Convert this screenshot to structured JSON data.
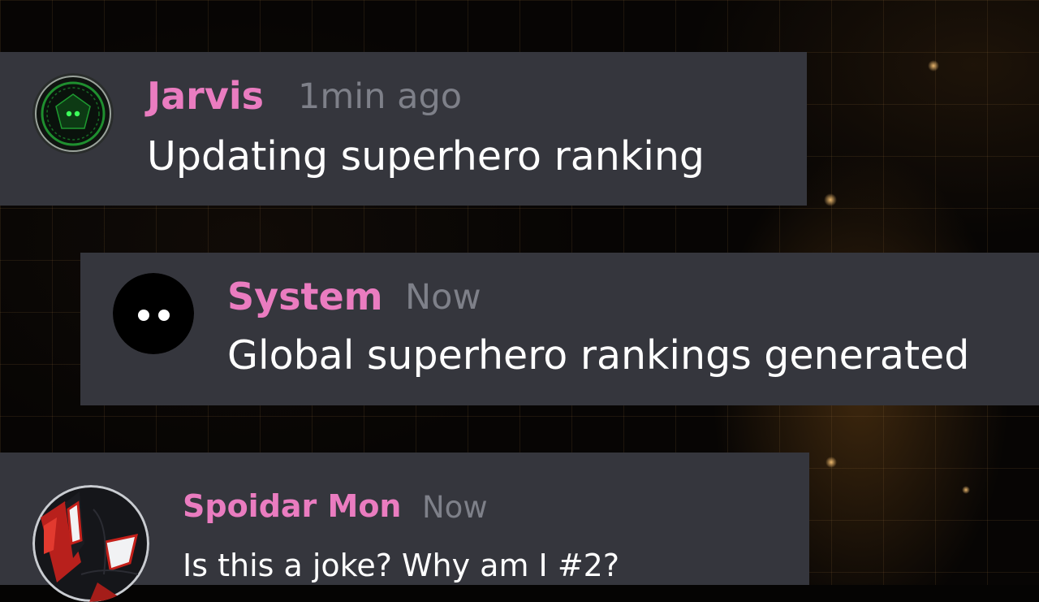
{
  "theme": {
    "panel_color": "#35363d",
    "username_color": "#ea7cc0",
    "timestamp_color": "#7e8089",
    "text_color": "#ffffff"
  },
  "messages": [
    {
      "username": "Jarvis",
      "timestamp": "1min ago",
      "text": "Updating superhero ranking",
      "avatar_icon": "jarvis-hud-icon"
    },
    {
      "username": "System",
      "timestamp": "Now",
      "text": "Global superhero rankings generated",
      "avatar_icon": "system-dots-icon"
    },
    {
      "username": "Spoidar Mon",
      "timestamp": "Now",
      "text": "Is this a joke? Why am I #2?",
      "avatar_icon": "spider-mask-icon"
    }
  ]
}
